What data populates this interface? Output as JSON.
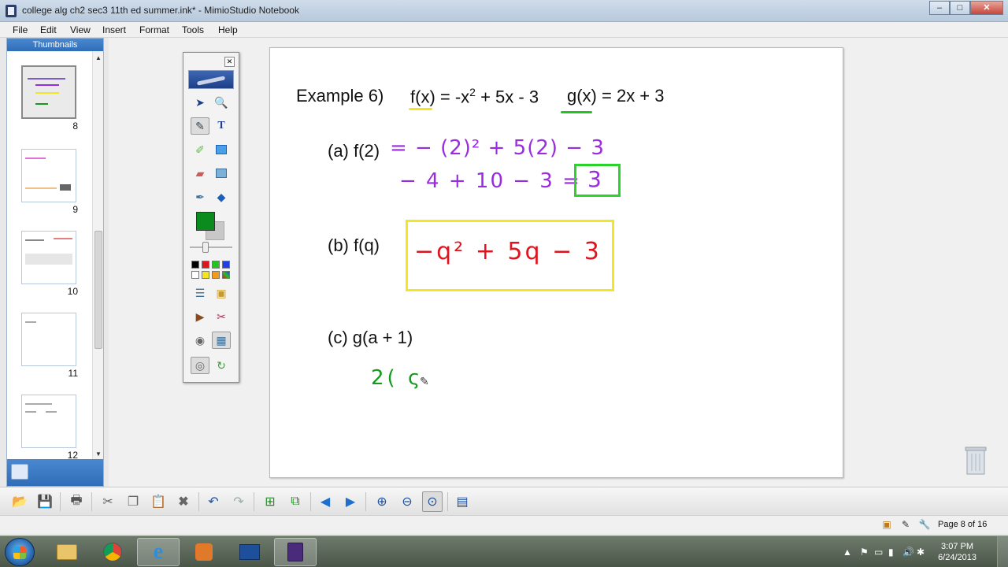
{
  "window": {
    "title": "college alg ch2 sec3 11th ed summer.ink* - MimioStudio Notebook",
    "minimize": "–",
    "maximize": "□",
    "close": "✕"
  },
  "menu": [
    "File",
    "Edit",
    "View",
    "Insert",
    "Format",
    "Tools",
    "Help"
  ],
  "thumbnails": {
    "header": "Thumbnails",
    "items": [
      {
        "number": "8",
        "selected": true
      },
      {
        "number": "9",
        "selected": false
      },
      {
        "number": "10",
        "selected": false
      },
      {
        "number": "11",
        "selected": false
      },
      {
        "number": "12",
        "selected": false
      }
    ]
  },
  "page": {
    "example_label": "Example 6)",
    "f_def": "f(x) = -x",
    "f_sup": "2",
    "f_rest": " + 5x - 3",
    "g_def": "g(x) = 2x + 3",
    "part_a": "(a)  f(",
    "part_a_arg": "2",
    "part_a_close": ")",
    "part_a_ink1": "= − (2)² + 5(2) − 3",
    "part_a_ink2": "− 4 + 10 − 3 =",
    "part_a_answer": "3",
    "part_b": "(b)  f(q)",
    "part_b_answer": "−q² + 5q − 3",
    "part_c": "(c)  g(a + 1)",
    "part_c_ink": "2( ς",
    "colors": {
      "purple_ink": "#9a2be0",
      "red_ink": "#e0141e",
      "green_ink": "#149a1c",
      "yellow_box": "#f2e521",
      "green_box": "#2bd42b"
    }
  },
  "palette": {
    "close": "✕",
    "tools": [
      "select-arrow",
      "zoom",
      "pen",
      "text",
      "highlighter",
      "shape",
      "eraser",
      "image",
      "eyedropper",
      "fill"
    ],
    "current_color": "#0b8a1d",
    "swatches": [
      "#000000",
      "#e0141e",
      "#22c422",
      "#1f3fe6",
      "#ffffff",
      "#f2e521",
      "#f29a1a",
      "#8a8a8a"
    ]
  },
  "status": {
    "page_info": "Page 8 of 16"
  },
  "taskbar": {
    "time": "3:07 PM",
    "date": "6/24/2013"
  }
}
